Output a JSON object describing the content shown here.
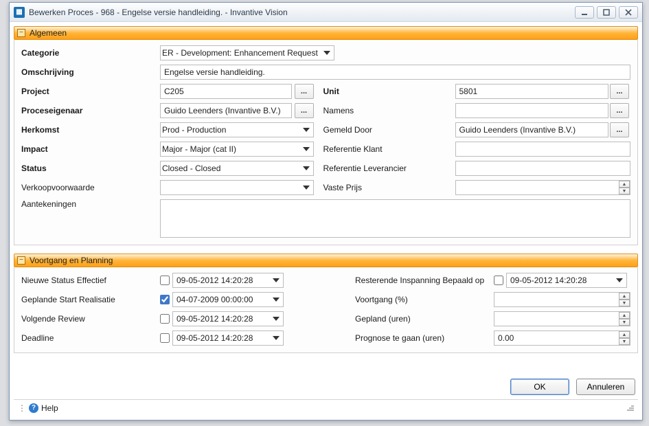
{
  "window": {
    "title": "Bewerken Proces - 968 - Engelse versie handleiding. - Invantive Vision"
  },
  "sections": {
    "general": "Algemeen",
    "planning": "Voortgang en Planning"
  },
  "labels": {
    "categorie": "Categorie",
    "omschrijving": "Omschrijving",
    "project": "Project",
    "proceseigenaar": "Proceseigenaar",
    "herkomst": "Herkomst",
    "impact": "Impact",
    "status": "Status",
    "verkoopvoorwaarde": "Verkoopvoorwaarde",
    "aantekeningen": "Aantekeningen",
    "unit": "Unit",
    "namens": "Namens",
    "gemelddoor": "Gemeld Door",
    "refklant": "Referentie Klant",
    "refleverancier": "Referentie Leverancier",
    "vasteprijs": "Vaste Prijs",
    "nieuwestatus": "Nieuwe Status Effectief",
    "geplandestart": "Geplande Start Realisatie",
    "volgendereview": "Volgende Review",
    "deadline": "Deadline",
    "resterende": "Resterende Inspanning Bepaald op",
    "voortgangpct": "Voortgang (%)",
    "geplanduren": "Gepland (uren)",
    "prognose": "Prognose te gaan (uren)"
  },
  "values": {
    "categorie": "ER - Development: Enhancement Request",
    "omschrijving": "Engelse versie handleiding.",
    "project": "C205",
    "proceseigenaar": "Guido Leenders (Invantive B.V.)",
    "herkomst": "Prod - Production",
    "impact": "Major - Major (cat II)",
    "status": "Closed - Closed",
    "verkoopvoorwaarde": "",
    "aantekeningen": "",
    "unit": "5801",
    "namens": "",
    "gemelddoor": "Guido Leenders (Invantive B.V.)",
    "refklant": "",
    "refleverancier": "",
    "vasteprijs": "",
    "nieuwestatus": "09-05-2012 14:20:28",
    "geplandestart": "04-07-2009 00:00:00",
    "volgendereview": "09-05-2012 14:20:28",
    "deadline": "09-05-2012 14:20:28",
    "resterende": "09-05-2012 14:20:28",
    "voortgangpct": "",
    "geplanduren": "",
    "prognose": "0.00"
  },
  "checks": {
    "nieuwestatus": false,
    "geplandestart": true,
    "volgendereview": false,
    "deadline": false,
    "resterende": false
  },
  "buttons": {
    "ok": "OK",
    "cancel": "Annuleren",
    "help": "Help"
  }
}
